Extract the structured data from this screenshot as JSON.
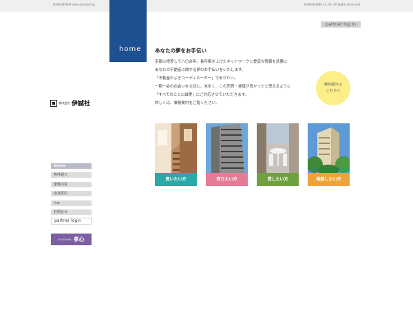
{
  "topbar": {
    "left_text": "ISAKUSEISHA www.example.jp",
    "right_text": "ISAKUSEISHA co.,ltd. All Rights Reserved"
  },
  "home_label": "home",
  "partner_login_top": "partner log in",
  "logo": {
    "prefix": "株式会社",
    "name": "伊誠社"
  },
  "content": {
    "headline": "あなたの夢をお手伝い",
    "paragraphs": [
      "京都に根差して八〇余年。長年築き上げたネットワークと豊富な情報を武器に",
      "あなたの不動産に関する夢のお手伝いをいたします。",
      "「不動産のよきコーディネーター」でありたい。",
      "一期一会の出会いを大切に、末永く、この売買・賃借が良かったと思えるように",
      "「すべてのことに誠実」にご対応させていただきます。",
      "詳しくは、業務案内をご覧ください。"
    ]
  },
  "circle_button": {
    "line1": "物件紹介は",
    "line2": "こちらへ"
  },
  "cards": [
    {
      "label": "買いたい方",
      "color": "#2aa9a6"
    },
    {
      "label": "売りたい方",
      "color": "#e47c97"
    },
    {
      "label": "貸したい方",
      "color": "#6fa13f"
    },
    {
      "label": "相談したい方",
      "color": "#eca43a"
    }
  ],
  "nav": {
    "items": [
      {
        "label": "home"
      },
      {
        "label": "物件紹介"
      },
      {
        "label": "業務内容"
      },
      {
        "label": "会社案内"
      },
      {
        "label": "link"
      },
      {
        "label": "お問合せ"
      }
    ],
    "partner_login": "partner login"
  },
  "koushin": {
    "en": "KOUSHIN",
    "jp": "孝心"
  },
  "colors": {
    "home_block": "#1d4f91",
    "nav_active": "#b9bbcb",
    "circle": "#fcef8a",
    "koushin": "#7c5fa3"
  }
}
